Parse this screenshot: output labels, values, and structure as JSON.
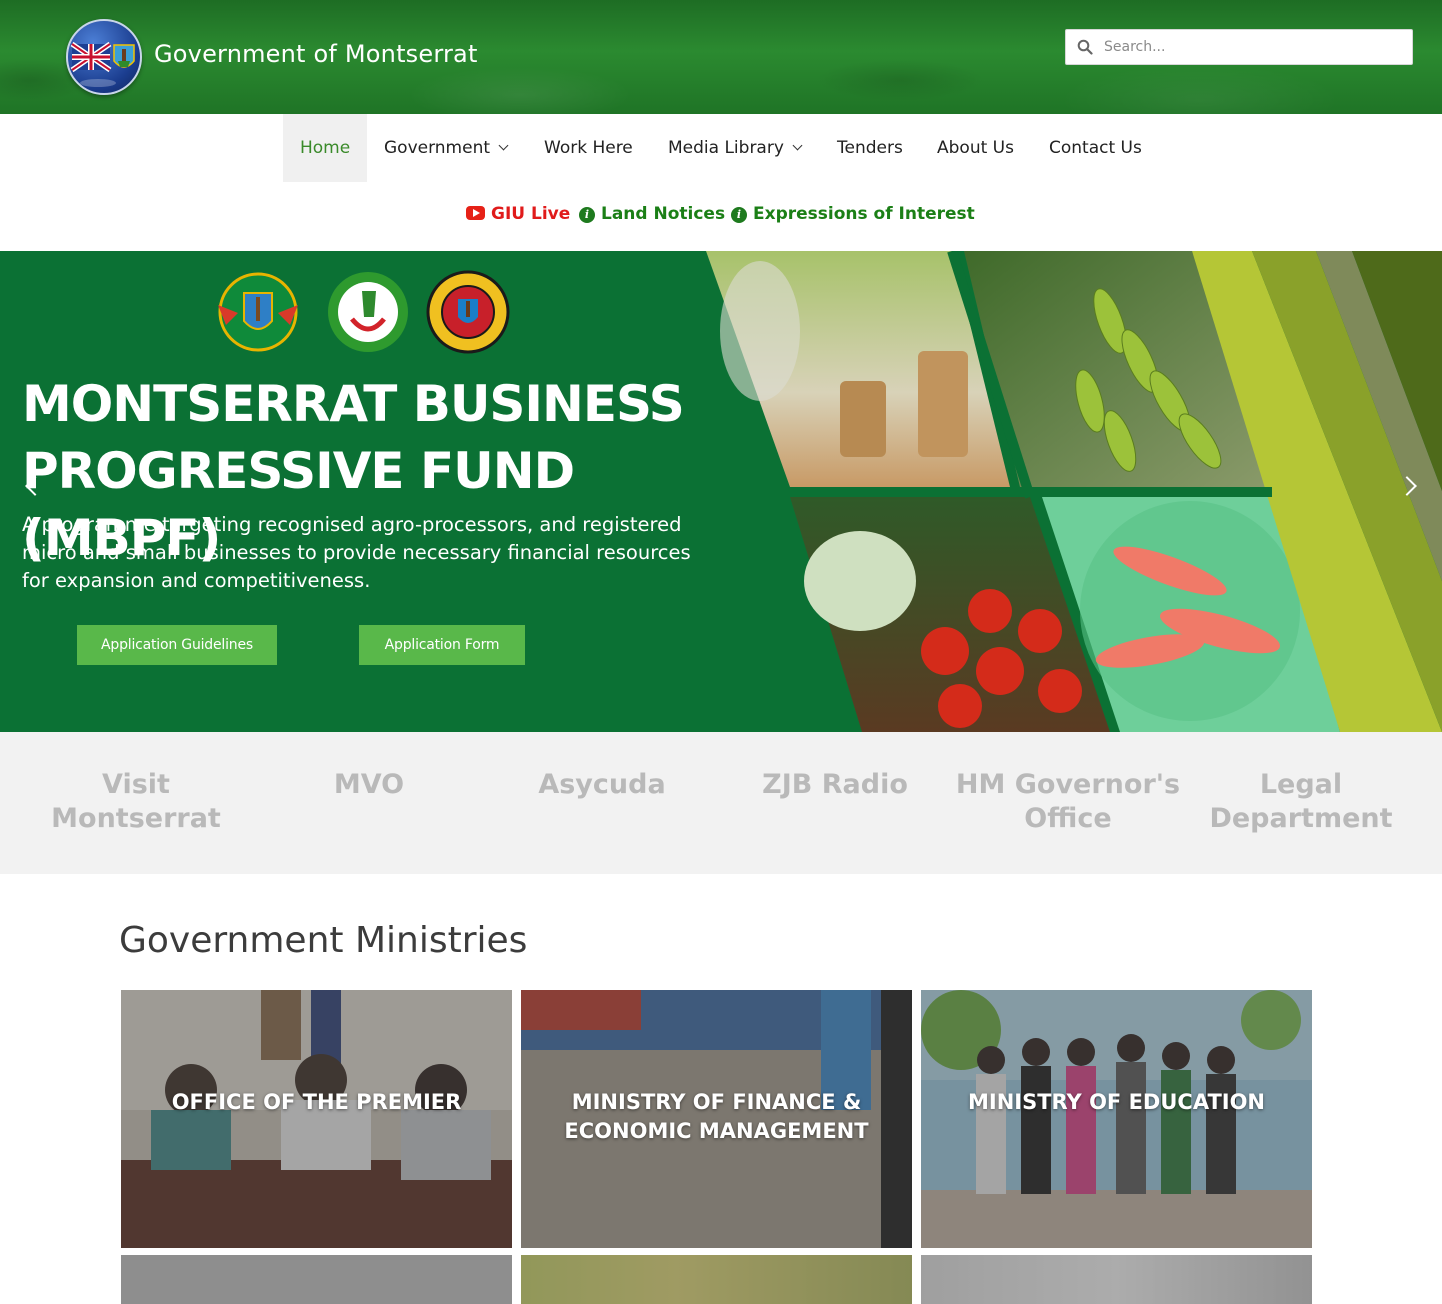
{
  "header": {
    "site_title": "Government of Montserrat",
    "search_placeholder": "Search..."
  },
  "nav": {
    "items": [
      {
        "label": "Home",
        "active": true,
        "dropdown": false
      },
      {
        "label": "Government",
        "active": false,
        "dropdown": true
      },
      {
        "label": "Work Here",
        "active": false,
        "dropdown": false
      },
      {
        "label": "Media Library",
        "active": false,
        "dropdown": true
      },
      {
        "label": "Tenders",
        "active": false,
        "dropdown": false
      },
      {
        "label": "About Us",
        "active": false,
        "dropdown": false
      },
      {
        "label": "Contact Us",
        "active": false,
        "dropdown": false
      }
    ]
  },
  "quick_links": [
    {
      "label": "GIU Live",
      "icon": "youtube-icon",
      "color": "#e01b1b"
    },
    {
      "label": "Land Notices",
      "icon": "info-icon",
      "color": "#1b7f16"
    },
    {
      "label": "Expressions of Interest",
      "icon": "info-icon",
      "color": "#1b7f16"
    }
  ],
  "hero": {
    "headline_line1": "MONTSERRAT BUSINESS",
    "headline_line2": "PROGRESSIVE FUND (MBPF)",
    "subtitle": "A programme targeting recognised agro-processors, and registered micro and small businesses to provide necessary financial resources for expansion and competitiveness.",
    "button_guidelines": "Application Guidelines",
    "button_form": "Application Form",
    "bg_color": "#0b7134"
  },
  "partners": [
    {
      "label": "Visit Montserrat"
    },
    {
      "label": "MVO"
    },
    {
      "label": "Asycuda"
    },
    {
      "label": "ZJB Radio"
    },
    {
      "label": "HM Governor's Office"
    },
    {
      "label": "Legal Department"
    }
  ],
  "ministries": {
    "title": "Government Ministries",
    "tiles": [
      {
        "label": "OFFICE OF THE PREMIER"
      },
      {
        "label": "MINISTRY OF FINANCE & ECONOMIC MANAGEMENT"
      },
      {
        "label": "MINISTRY OF EDUCATION"
      }
    ]
  }
}
